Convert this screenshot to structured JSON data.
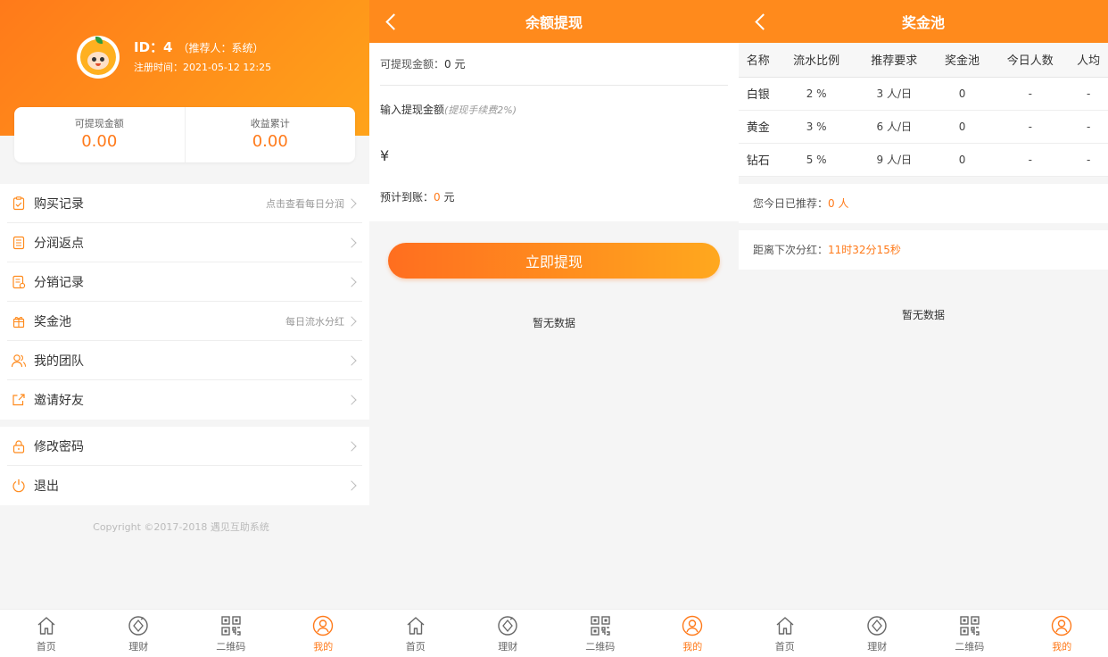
{
  "profile": {
    "id_text": "ID：4",
    "referrer": "（推荐人：系统）",
    "reg_time": "注册时间：2021-05-12 12:25",
    "stats": [
      {
        "label": "可提现金额",
        "value": "0.00"
      },
      {
        "label": "收益累计",
        "value": "0.00"
      }
    ],
    "menu_group1": [
      {
        "label": "购买记录",
        "hint": "点击查看每日分润",
        "icon": "order-icon"
      },
      {
        "label": "分润返点",
        "hint": "",
        "icon": "list-icon"
      },
      {
        "label": "分销记录",
        "hint": "",
        "icon": "records-icon"
      },
      {
        "label": "奖金池",
        "hint": "每日流水分红",
        "icon": "gift-icon"
      },
      {
        "label": "我的团队",
        "hint": "",
        "icon": "team-icon"
      },
      {
        "label": "邀请好友",
        "hint": "",
        "icon": "share-icon"
      }
    ],
    "menu_group2": [
      {
        "label": "修改密码",
        "icon": "lock-icon"
      },
      {
        "label": "退出",
        "icon": "power-icon"
      }
    ],
    "copyright": "Copyright ©2017-2018 遇见互助系统"
  },
  "withdraw": {
    "title": "余额提现",
    "available_label": "可提现金额：",
    "available_value": "0 元",
    "input_label": "输入提现金额",
    "fee_note": "(提现手续费2%)",
    "currency": "¥",
    "expected_label": "预计到账：",
    "expected_value": "0",
    "expected_unit": "元",
    "button": "立即提现",
    "empty": "暂无数据"
  },
  "pool": {
    "title": "奖金池",
    "columns": [
      "名称",
      "流水比例",
      "推荐要求",
      "奖金池",
      "今日人数",
      "人均"
    ],
    "rows": [
      [
        "白银",
        "2 %",
        "3 人/日",
        "0",
        "-",
        "-"
      ],
      [
        "黄金",
        "3 %",
        "6 人/日",
        "0",
        "-",
        "-"
      ],
      [
        "钻石",
        "5 %",
        "9 人/日",
        "0",
        "-",
        "-"
      ]
    ],
    "today_label": "您今日已推荐：",
    "today_value": "0 人",
    "countdown_label": "距离下次分红：",
    "countdown_value": "11时32分15秒",
    "empty": "暂无数据"
  },
  "tabs": [
    {
      "label": "首页",
      "icon": "home-icon"
    },
    {
      "label": "理财",
      "icon": "finance-icon"
    },
    {
      "label": "二维码",
      "icon": "qrcode-icon"
    },
    {
      "label": "我的",
      "icon": "user-icon"
    }
  ],
  "colors": {
    "accent": "#ff8a1c",
    "gradient_start": "#ff6e1f",
    "gradient_end": "#ffa81e"
  }
}
